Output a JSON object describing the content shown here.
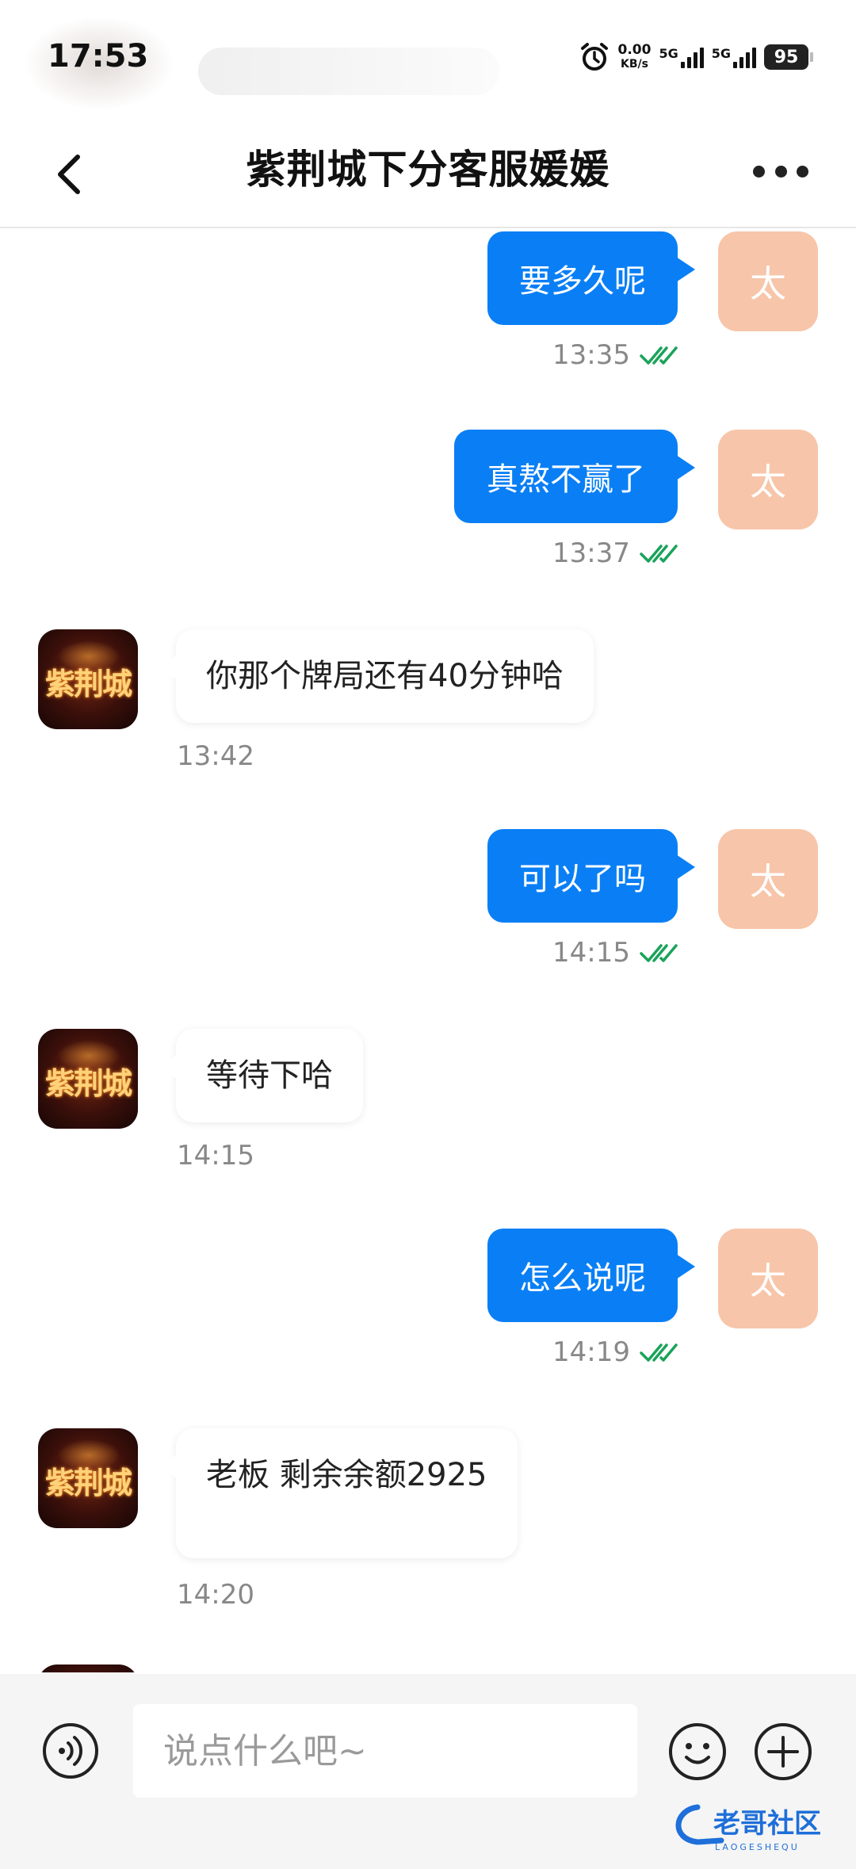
{
  "status_bar": {
    "time": "17:53",
    "net_speed_value": "0.00",
    "net_speed_unit": "KB/s",
    "sim1": "5G",
    "sim2": "5G",
    "battery": "95",
    "alarm_icon": "alarm-clock-icon"
  },
  "header": {
    "title": "紫荆城下分客服媛媛",
    "back_icon": "chevron-left-icon",
    "more_icon": "more-dots-icon"
  },
  "user": {
    "avatar_text": "太",
    "avatar_color": "#f7c5a9"
  },
  "service": {
    "avatar_text": "紫荆城"
  },
  "colors": {
    "outgoing_bubble": "#0a7ff5",
    "read_check": "#1aa35a"
  },
  "messages": [
    {
      "side": "out",
      "text": "要多久呢",
      "time": "13:35",
      "read": true
    },
    {
      "side": "out",
      "text": "真熬不赢了",
      "time": "13:37",
      "read": true
    },
    {
      "side": "in",
      "text": "你那个牌局还有40分钟哈",
      "time": "13:42"
    },
    {
      "side": "out",
      "text": "可以了吗",
      "time": "14:15",
      "read": true
    },
    {
      "side": "in",
      "text": "等待下哈",
      "time": "14:15"
    },
    {
      "side": "out",
      "text": "怎么说呢",
      "time": "14:19",
      "read": true
    },
    {
      "side": "in",
      "text": "老板  剩余余额2925",
      "time": "14:20"
    }
  ],
  "input": {
    "placeholder": "说点什么吧~",
    "value": "",
    "voice_icon": "voice-icon",
    "emoji_icon": "emoji-icon",
    "plus_icon": "plus-icon"
  },
  "watermark": {
    "main": "老哥社区",
    "sub": "LAOGESHEQU"
  }
}
